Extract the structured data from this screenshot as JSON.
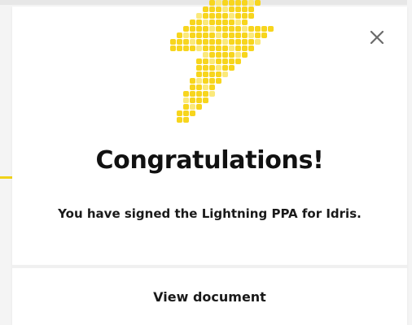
{
  "modal": {
    "title": "Congratulations!",
    "message": "You have signed the Lightning PPA for Idris.",
    "view_document_label": "View document",
    "close_icon": "close-icon",
    "hero_icon": "lightning-bolt-icon"
  },
  "colors": {
    "accent": "#f7d51d",
    "accent_light": "#fbe97a",
    "text": "#111111",
    "close": "#6b6b6b"
  }
}
